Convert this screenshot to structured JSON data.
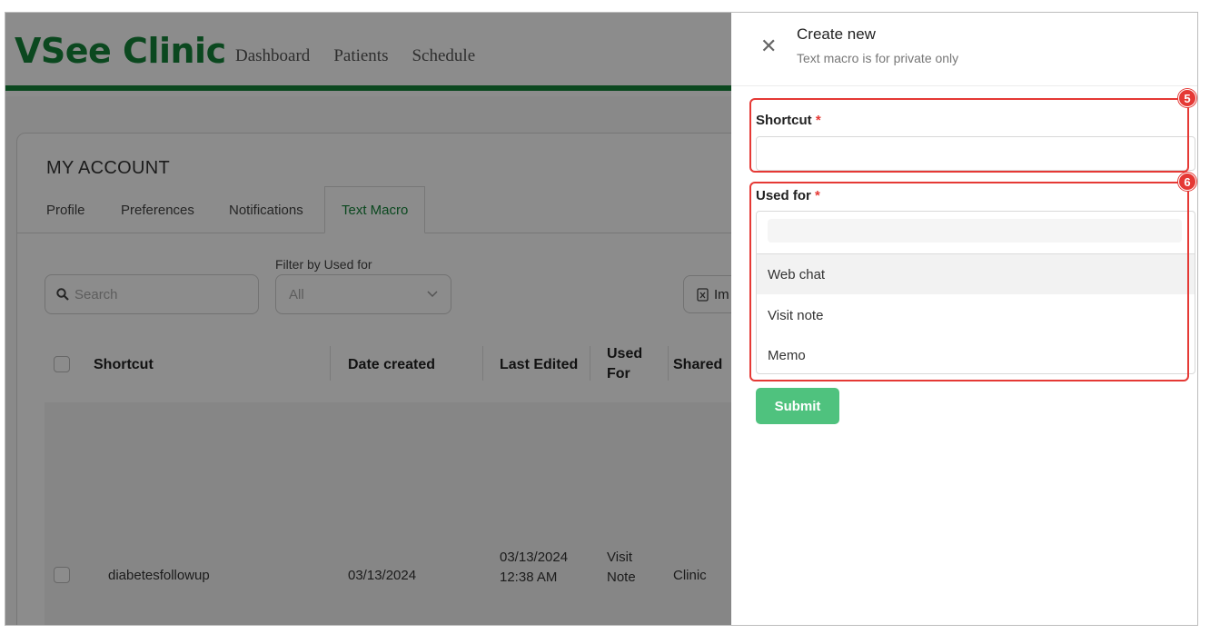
{
  "app": {
    "logo": "VSee Clinic",
    "nav": [
      "Dashboard",
      "Patients",
      "Schedule"
    ]
  },
  "account": {
    "title": "MY ACCOUNT",
    "tabs": [
      "Profile",
      "Preferences",
      "Notifications",
      "Text Macro"
    ],
    "active_tab": "Text Macro"
  },
  "toolbar": {
    "search_placeholder": "Search",
    "filter_label": "Filter by Used for",
    "filter_value": "All",
    "import_label": "Im"
  },
  "table": {
    "headers": [
      "Shortcut",
      "Date created",
      "Last Edited",
      "Used For",
      "Shared"
    ],
    "used_for_header_lines": [
      "Used",
      "For"
    ],
    "rows": [
      {
        "shortcut": "diabetesfollowup",
        "date_created": "03/13/2024",
        "last_edited": [
          "03/13/2024",
          "12:38 AM"
        ],
        "used_for": [
          "Visit",
          "Note"
        ],
        "shared": "Clinic"
      }
    ]
  },
  "drawer": {
    "title": "Create new",
    "subtitle": "Text macro is for private only",
    "close_icon": "close-icon",
    "shortcut_label": "Shortcut",
    "used_for_label": "Used for",
    "required_marker": "*",
    "options": [
      "Web chat",
      "Visit note",
      "Memo"
    ],
    "submit_label": "Submit"
  },
  "annotations": [
    "5",
    "6"
  ],
  "colors": {
    "brand_green": "#14843a",
    "submit_green": "#4fc27e",
    "annotation_red": "#e53935"
  }
}
